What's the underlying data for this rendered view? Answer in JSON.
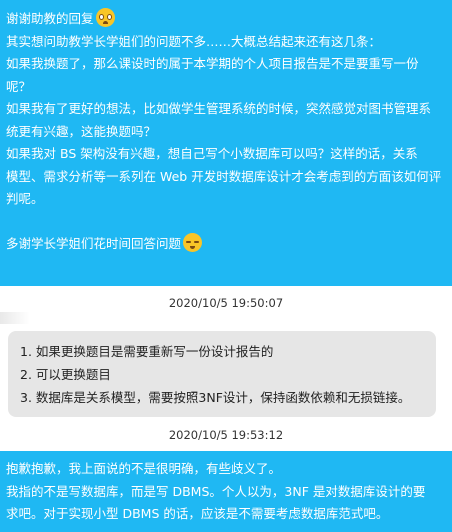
{
  "messages": {
    "first": {
      "greeting": "谢谢助教的回复",
      "greeting_emoji": "pleading-face",
      "lines": [
        "其实想问助教学长学姐们的问题不多……大概总结起来还有这几条：",
        "如果我换题了，那么课设时的属于本学期的个人项目报告是不是要重写一份",
        "呢？",
        "如果我有了更好的想法，比如做学生管理系统的时候，突然感觉对图书管理系",
        "统更有兴趣，这能换题吗？",
        "如果我对 BS 架构没有兴趣，想自己写个小数据库可以吗？这样的话，关系",
        "模型、需求分析等一系列在 Web 开发时数据库设计才会考虑到的方面该如何评",
        "判呢。"
      ],
      "closing": "多谢学长学姐们花时间回答问题",
      "closing_emoji": "disappointed-face"
    },
    "second": {
      "timestamp": "2020/10/5 19:50:07",
      "items": [
        "1. 如果更换题目是需要重新写一份设计报告的",
        "2. 可以更换题目",
        "3. 数据库是关系模型，需要按照3NF设计，保持函数依赖和无损链接。"
      ]
    },
    "third": {
      "timestamp": "2020/10/5 19:53:12",
      "lines": [
        "抱歉抱歉，我上面说的不是很明确，有些歧义了。",
        "我指的不是写数据库，而是写 DBMS。个人以为，3NF 是对数据库设计的要",
        "求吧。对于实现小型 DBMS 的话，应该是不需要考虑数据库范式吧。"
      ]
    }
  },
  "colors": {
    "sender_bubble": "#1fb8f3",
    "reply_bubble": "#e6e6e6",
    "timestamp_text": "#333333"
  }
}
